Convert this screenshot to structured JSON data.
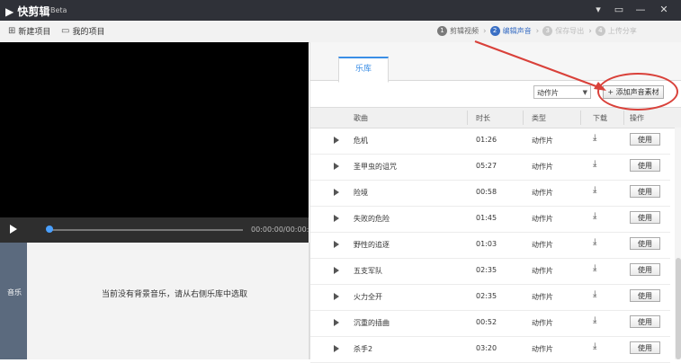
{
  "window": {
    "app_title": "快剪辑",
    "badge": "Beta",
    "controls": [
      "▾",
      "▭",
      "—",
      "✕"
    ]
  },
  "toolbar": {
    "new_project": "新建项目",
    "my_projects": "我的项目"
  },
  "steps": [
    {
      "num": "1",
      "label": "剪辑视频",
      "state": "done"
    },
    {
      "num": "2",
      "label": "编辑声音",
      "state": "active"
    },
    {
      "num": "3",
      "label": "保存导出",
      "state": "dim"
    },
    {
      "num": "4",
      "label": "上传分享",
      "state": "dim"
    }
  ],
  "player": {
    "time": "00:00:00/00:00:00"
  },
  "music_panel": {
    "side_label": "音乐",
    "empty_message": "当前没有背景音乐，请从右侧乐库中选取"
  },
  "library": {
    "tab": "乐库",
    "filter_value": "动作片",
    "add_button": "添加声音素材",
    "columns": {
      "name": "歌曲",
      "duration": "时长",
      "type": "类型",
      "download": "下载",
      "action": "操作"
    },
    "rows": [
      {
        "name": "危机",
        "duration": "01:26",
        "type": "动作片",
        "action": "使用"
      },
      {
        "name": "圣甲虫的诅咒",
        "duration": "05:27",
        "type": "动作片",
        "action": "使用"
      },
      {
        "name": "险境",
        "duration": "00:58",
        "type": "动作片",
        "action": "使用"
      },
      {
        "name": "失败的危险",
        "duration": "01:45",
        "type": "动作片",
        "action": "使用"
      },
      {
        "name": "野性的追逐",
        "duration": "01:03",
        "type": "动作片",
        "action": "使用"
      },
      {
        "name": "五支军队",
        "duration": "02:35",
        "type": "动作片",
        "action": "使用"
      },
      {
        "name": "火力全开",
        "duration": "02:35",
        "type": "动作片",
        "action": "使用"
      },
      {
        "name": "沉重的插曲",
        "duration": "00:52",
        "type": "动作片",
        "action": "使用"
      },
      {
        "name": "杀手2",
        "duration": "03:20",
        "type": "动作片",
        "action": "使用"
      }
    ]
  },
  "colors": {
    "titlebar": "#2f3138",
    "accent": "#3a8ee6",
    "annotation": "#d9413a"
  }
}
